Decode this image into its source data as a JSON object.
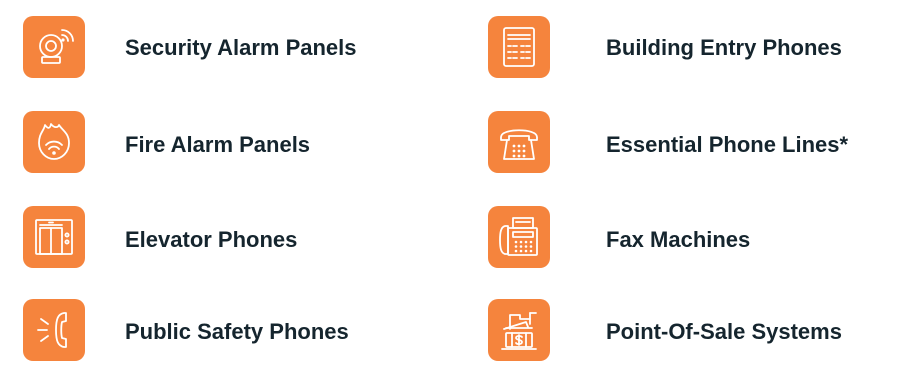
{
  "colors": {
    "tile_background": "#f5843d",
    "icon_stroke": "#ffffff",
    "label_text": "#15252e"
  },
  "left_column": [
    {
      "label": "Security Alarm Panels",
      "icon": "alarm-bell-icon"
    },
    {
      "label": "Fire Alarm Panels",
      "icon": "fire-alarm-icon"
    },
    {
      "label": "Elevator Phones",
      "icon": "elevator-icon"
    },
    {
      "label": "Public Safety Phones",
      "icon": "emergency-phone-icon"
    }
  ],
  "right_column": [
    {
      "label": "Building Entry Phones",
      "icon": "entry-intercom-icon"
    },
    {
      "label": "Essential Phone Lines*",
      "icon": "desk-phone-icon"
    },
    {
      "label": "Fax Machines",
      "icon": "fax-machine-icon"
    },
    {
      "label": "Point-Of-Sale Systems",
      "icon": "card-payment-icon"
    }
  ]
}
